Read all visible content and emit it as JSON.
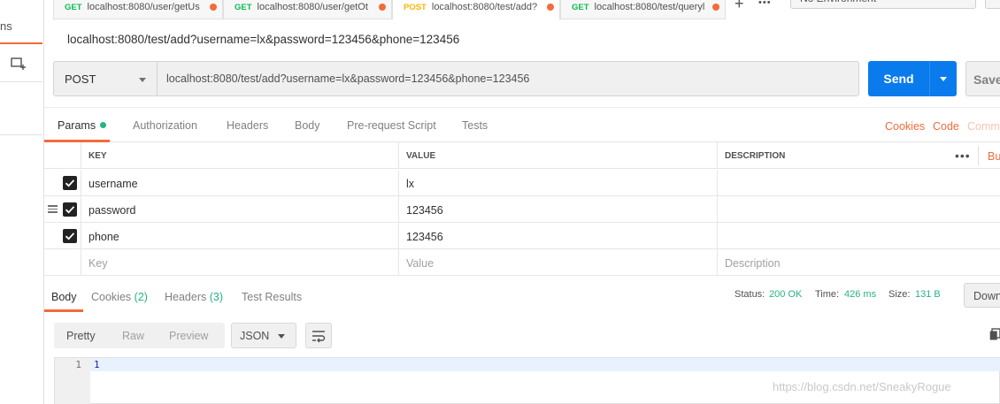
{
  "sidebar": {
    "tab_stub": "ns"
  },
  "tabs": [
    {
      "method": "GET",
      "label": "localhost:8080/user/getUs"
    },
    {
      "method": "GET",
      "label": "localhost:8080/user/getOt"
    },
    {
      "method": "POST",
      "label": "localhost:8080/test/add? "
    },
    {
      "method": "GET",
      "label": "localhost:8080/test/queryl"
    }
  ],
  "tab_actions": {
    "add": "+",
    "more": "•••"
  },
  "environment": "No Environment",
  "request": {
    "title": "localhost:8080/test/add?username=lx&password=123456&phone=123456",
    "method": "POST",
    "url": "localhost:8080/test/add?username=lx&password=123456&phone=123456",
    "send_label": "Send",
    "save_label": "Save"
  },
  "request_tabs": [
    "Params",
    "Authorization",
    "Headers",
    "Body",
    "Pre-request Script",
    "Tests"
  ],
  "request_links": [
    "Cookies",
    "Code",
    "Comm"
  ],
  "params": {
    "headers": [
      "KEY",
      "VALUE",
      "DESCRIPTION"
    ],
    "more": "•••",
    "bulk": "Bu",
    "rows": [
      {
        "key": "username",
        "value": "lx",
        "description": ""
      },
      {
        "key": "password",
        "value": "123456",
        "description": ""
      },
      {
        "key": "phone",
        "value": "123456",
        "description": ""
      }
    ],
    "placeholders": {
      "key": "Key",
      "value": "Value",
      "description": "Description"
    }
  },
  "response_tabs": {
    "body": "Body",
    "cookies": "Cookies",
    "cookies_count": "(2)",
    "headers": "Headers",
    "headers_count": "(3)",
    "tests": "Test Results"
  },
  "status": {
    "status_label": "Status:",
    "status_value": "200 OK",
    "time_label": "Time:",
    "time_value": "426 ms",
    "size_label": "Size:",
    "size_value": "131 B",
    "download": "Down"
  },
  "response_toolbar": {
    "formats": [
      "Pretty",
      "Raw",
      "Preview"
    ],
    "language": "JSON"
  },
  "response_body": {
    "line": "1",
    "code": "1"
  },
  "watermark": "https://blog.csdn.net/SneakyRogue",
  "colors": {
    "accent": "#f26b3a",
    "send": "#097bed",
    "success": "#26b47f"
  }
}
